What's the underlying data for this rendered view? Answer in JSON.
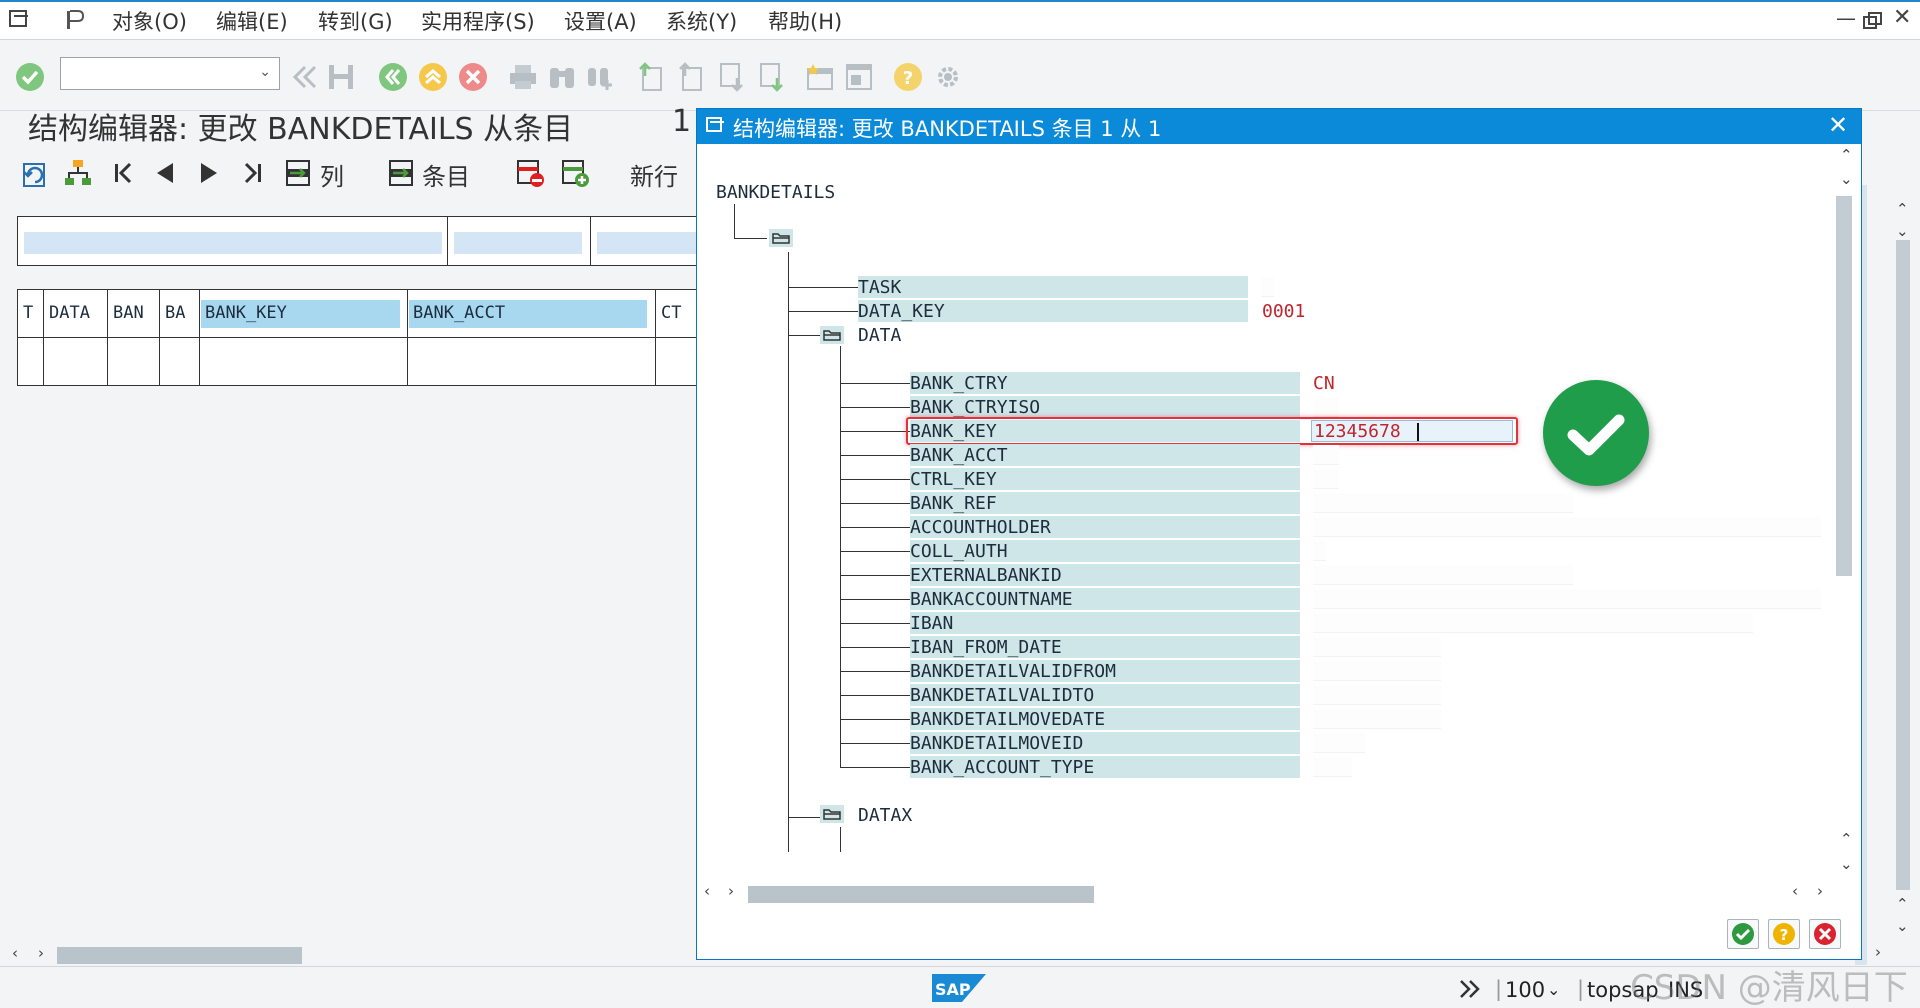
{
  "menu": {
    "items": [
      "对象(O)",
      "编辑(E)",
      "转到(G)",
      "实用程序(S)",
      "设置(A)",
      "系统(Y)",
      "帮助(H)"
    ]
  },
  "toolbar": {
    "command_field_value": ""
  },
  "screen": {
    "title": "结构编辑器: 更改 BANKDETAILS 从条目",
    "title_count": "1",
    "app_toolbar": {
      "column_label": "列",
      "entry_label": "条目",
      "new_row_label": "新行"
    },
    "table": {
      "columns": [
        "T",
        "DATA",
        "BAN",
        "BA",
        "BANK_KEY",
        "BANK_ACCT",
        "CT"
      ]
    }
  },
  "dialog": {
    "title": "结构编辑器: 更改 BANKDETAILS 条目 1 从 1",
    "root": "BANKDETAILS",
    "fields_top": [
      {
        "label": "TASK",
        "value": ""
      },
      {
        "label": "DATA_KEY",
        "value": "0001"
      }
    ],
    "data_node": "DATA",
    "data_fields": [
      {
        "label": "BANK_CTRY",
        "value": "CN"
      },
      {
        "label": "BANK_CTRYISO",
        "value": ""
      },
      {
        "label": "BANK_KEY",
        "value": "12345678"
      },
      {
        "label": "BANK_ACCT",
        "value": ""
      },
      {
        "label": "CTRL_KEY",
        "value": ""
      },
      {
        "label": "BANK_REF",
        "value": ""
      },
      {
        "label": "ACCOUNTHOLDER",
        "value": ""
      },
      {
        "label": "COLL_AUTH",
        "value": ""
      },
      {
        "label": "EXTERNALBANKID",
        "value": ""
      },
      {
        "label": "BANKACCOUNTNAME",
        "value": ""
      },
      {
        "label": "IBAN",
        "value": ""
      },
      {
        "label": "IBAN_FROM_DATE",
        "value": ""
      },
      {
        "label": "BANKDETAILVALIDFROM",
        "value": ""
      },
      {
        "label": "BANKDETAILVALIDTO",
        "value": ""
      },
      {
        "label": "BANKDETAILMOVEDATE",
        "value": ""
      },
      {
        "label": "BANKDETAILMOVEID",
        "value": ""
      },
      {
        "label": "BANK_ACCOUNT_TYPE",
        "value": ""
      }
    ],
    "datax_node": "DATAX"
  },
  "status": {
    "logo": "SAP",
    "zoom": "100",
    "server": "topsap",
    "mode": "INS"
  },
  "watermark": "CSDN @清风日下",
  "colors": {
    "brand_blue": "#0a8ad8",
    "tree_label_bg": "#cfe6e8",
    "value_red": "#c0262d",
    "success_green": "#1f9d4b",
    "highlight_red": "#e0333b"
  }
}
